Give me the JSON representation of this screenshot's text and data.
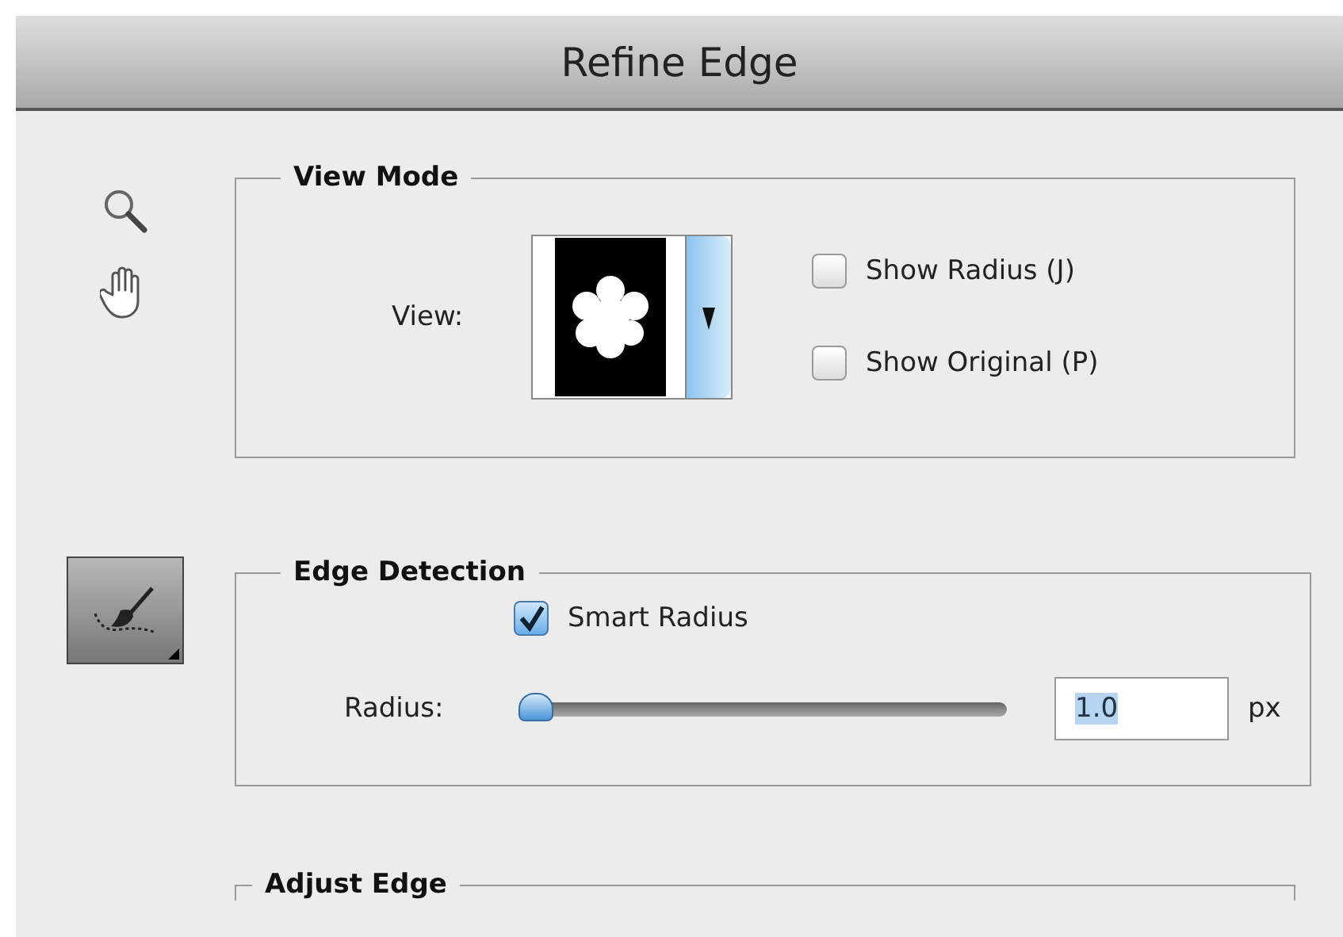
{
  "window": {
    "title": "Refine Edge"
  },
  "view_mode": {
    "legend": "View Mode",
    "view_label": "View:",
    "options": [
      {
        "label": "Show Radius (J)",
        "checked": false
      },
      {
        "label": "Show Original (P)",
        "checked": false
      }
    ]
  },
  "edge_detection": {
    "legend": "Edge Detection",
    "smart_radius": {
      "label": "Smart Radius",
      "checked": true
    },
    "radius": {
      "label": "Radius:",
      "level": 0.02,
      "value": "1.0",
      "unit": "px"
    }
  },
  "adjust_edge": {
    "legend": "Adjust Edge"
  }
}
